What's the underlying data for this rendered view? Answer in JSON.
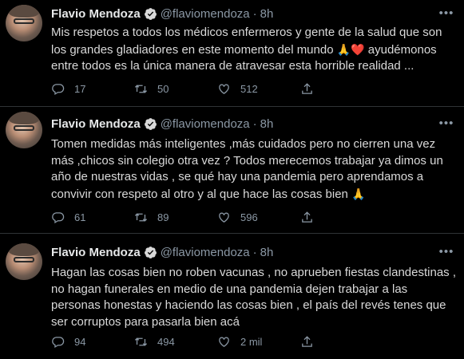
{
  "tweets": [
    {
      "name": "Flavio Mendoza",
      "handle": "@flaviomendoza",
      "dot": "·",
      "time": "8h",
      "text_a": "Mis respetos a todos los médicos enfermeros y gente de la salud que son los grandes gladiadores en este momento del mundo ",
      "emoji_a": "🙏",
      "emoji_b": "❤️",
      "text_b": " ayudémonos entre todos es la única manera de atravesar esta horrible realidad ...",
      "replies": "17",
      "retweets": "50",
      "likes": "512"
    },
    {
      "name": "Flavio Mendoza",
      "handle": "@flaviomendoza",
      "dot": "·",
      "time": "8h",
      "text_a": "Tomen medidas más inteligentes ,más cuidados pero no cierren una vez más ,chicos  sin colegio otra vez ? Todos merecemos trabajar ya dimos un año de nuestras vidas , se qué hay una pandemia pero aprendamos a convivir con respeto al otro y al que hace las cosas bien ",
      "emoji_a": "🙏",
      "replies": "61",
      "retweets": "89",
      "likes": "596"
    },
    {
      "name": "Flavio Mendoza",
      "handle": "@flaviomendoza",
      "dot": "·",
      "time": "8h",
      "text_a": "Hagan las cosas bien no roben vacunas , no aprueben fiestas clandestinas , no hagan funerales en medio de una pandemia dejen trabajar a las personas honestas y haciendo las cosas bien , el país del revés tenes que ser corruptos para pasarla bien acá",
      "replies": "94",
      "retweets": "494",
      "likes": "2 mil"
    }
  ],
  "icons": {
    "verified": "verified-badge-icon",
    "more": "more-icon",
    "reply": "reply-icon",
    "retweet": "retweet-icon",
    "like": "like-icon",
    "share": "share-icon"
  },
  "colors": {
    "background": "#000000",
    "text": "#d9d9d9",
    "muted": "#8b98a5",
    "verified": "#1d9bf0",
    "divider": "#2f3336"
  }
}
